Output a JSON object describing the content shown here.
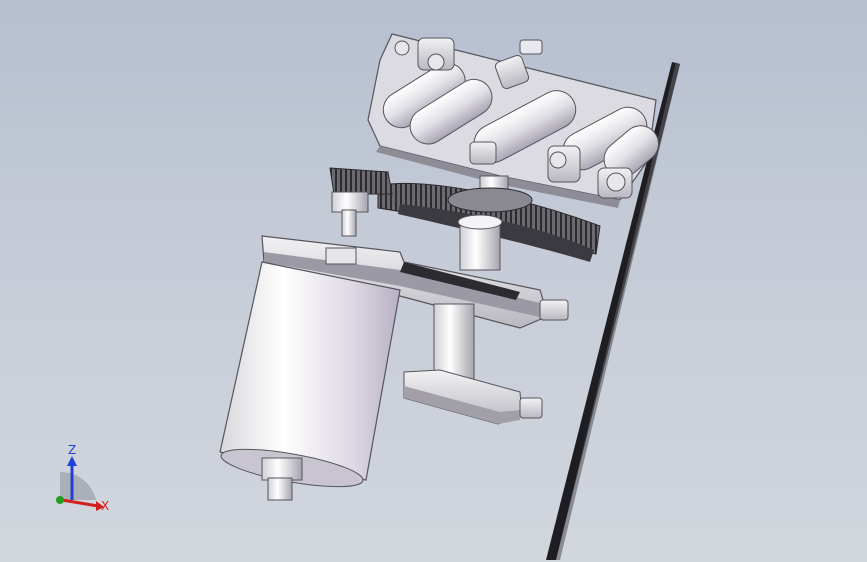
{
  "viewport": {
    "model": "mecanum-wheel-drive-assembly",
    "background_top": "#b6bfd0",
    "background_bottom": "#d2d6dd"
  },
  "triad": {
    "z_label": "Z",
    "x_label": "X",
    "z_color": "#1f3fd6",
    "x_color": "#d21f1f",
    "y_color": "#1fa01f"
  }
}
